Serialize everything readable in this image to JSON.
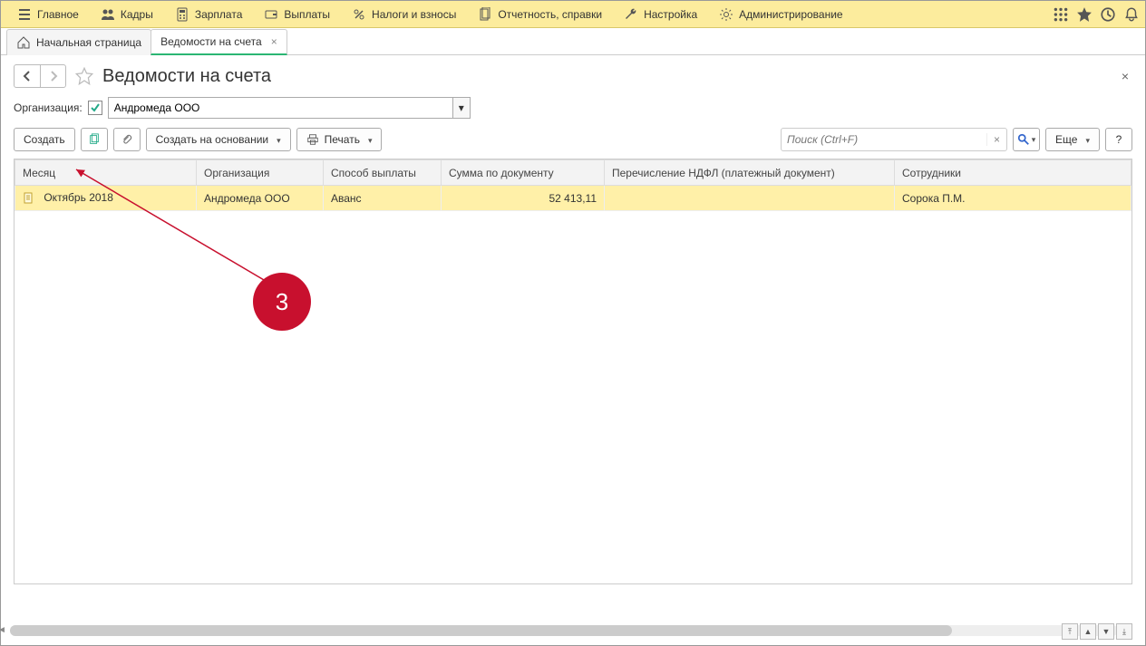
{
  "topmenu": {
    "items": [
      {
        "label": "Главное",
        "icon": "menu"
      },
      {
        "label": "Кадры",
        "icon": "people"
      },
      {
        "label": "Зарплата",
        "icon": "calc"
      },
      {
        "label": "Выплаты",
        "icon": "wallet"
      },
      {
        "label": "Налоги и взносы",
        "icon": "percent"
      },
      {
        "label": "Отчетность, справки",
        "icon": "doc"
      },
      {
        "label": "Настройка",
        "icon": "wrench"
      },
      {
        "label": "Администрирование",
        "icon": "gear"
      }
    ]
  },
  "tabs": [
    {
      "label": "Начальная страница",
      "icon": "home",
      "closable": false,
      "active": false
    },
    {
      "label": "Ведомости на счета",
      "closable": true,
      "active": true
    }
  ],
  "page": {
    "title": "Ведомости на счета"
  },
  "filter": {
    "label": "Организация:",
    "checked": true,
    "value": "Андромеда ООО"
  },
  "toolbar": {
    "create": "Создать",
    "create_based": "Создать на основании",
    "print": "Печать",
    "search_placeholder": "Поиск (Ctrl+F)",
    "more": "Еще",
    "help": "?"
  },
  "table": {
    "columns": [
      "Месяц",
      "Организация",
      "Способ выплаты",
      "Сумма по документу",
      "Перечисление НДФЛ (платежный документ)",
      "Сотрудники"
    ],
    "rows": [
      {
        "month": "Октябрь 2018",
        "org": "Андромеда ООО",
        "method": "Аванс",
        "sum": "52 413,11",
        "ndfl": "",
        "employees": "Сорока П.М.",
        "selected": true
      }
    ]
  },
  "annotation": {
    "num": "3"
  }
}
